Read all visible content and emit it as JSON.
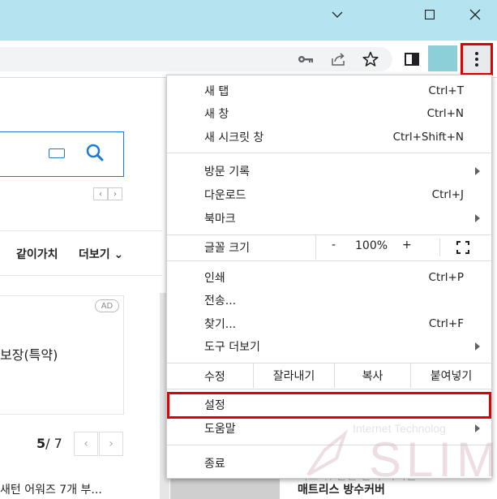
{
  "window": {
    "min_icon": "chevron-down",
    "max_icon": "square",
    "close_icon": "close"
  },
  "toolbar": {
    "icons": [
      "key-icon",
      "share-icon",
      "star-icon",
      "side-panel-icon"
    ]
  },
  "page": {
    "nav_item1": "같이가치",
    "nav_item2": "더보기",
    "ad_badge": "AD",
    "ad_text": "보장(특약)",
    "pager_current": "5",
    "pager_total": "/ 7",
    "bottom_text": "새턴 어워즈 7개 부...",
    "product_text": "매트리스 방수커버",
    "product_text_faded": "이트 위 안될 빈지 다시한"
  },
  "menu": {
    "group1": [
      {
        "label": "새 탭",
        "shortcut": "Ctrl+T"
      },
      {
        "label": "새 창",
        "shortcut": "Ctrl+N"
      },
      {
        "label": "새 시크릿 창",
        "shortcut": "Ctrl+Shift+N"
      }
    ],
    "group2": [
      {
        "label": "방문 기록",
        "shortcut": ""
      },
      {
        "label": "다운로드",
        "shortcut": "Ctrl+J"
      },
      {
        "label": "북마크",
        "shortcut": ""
      }
    ],
    "zoom": {
      "label": "글꼴 크기",
      "minus": "-",
      "value": "100%",
      "plus": "+"
    },
    "group3": [
      {
        "label": "인쇄",
        "shortcut": "Ctrl+P"
      },
      {
        "label": "전송...",
        "shortcut": ""
      },
      {
        "label": "찾기...",
        "shortcut": "Ctrl+F"
      },
      {
        "label": "도구 더보기",
        "shortcut": ""
      }
    ],
    "edit": {
      "label": "수정",
      "cut": "잘라내기",
      "copy": "복사",
      "paste": "붙여넣기"
    },
    "settings": "설정",
    "help": "도움말",
    "exit": "종료"
  },
  "watermark": {
    "small": "Internet Technolog",
    "big": "SLIM"
  },
  "colors": {
    "titlebar": "#b6e3f0",
    "highlight": "#e00000",
    "accent": "#1a7bd6"
  }
}
